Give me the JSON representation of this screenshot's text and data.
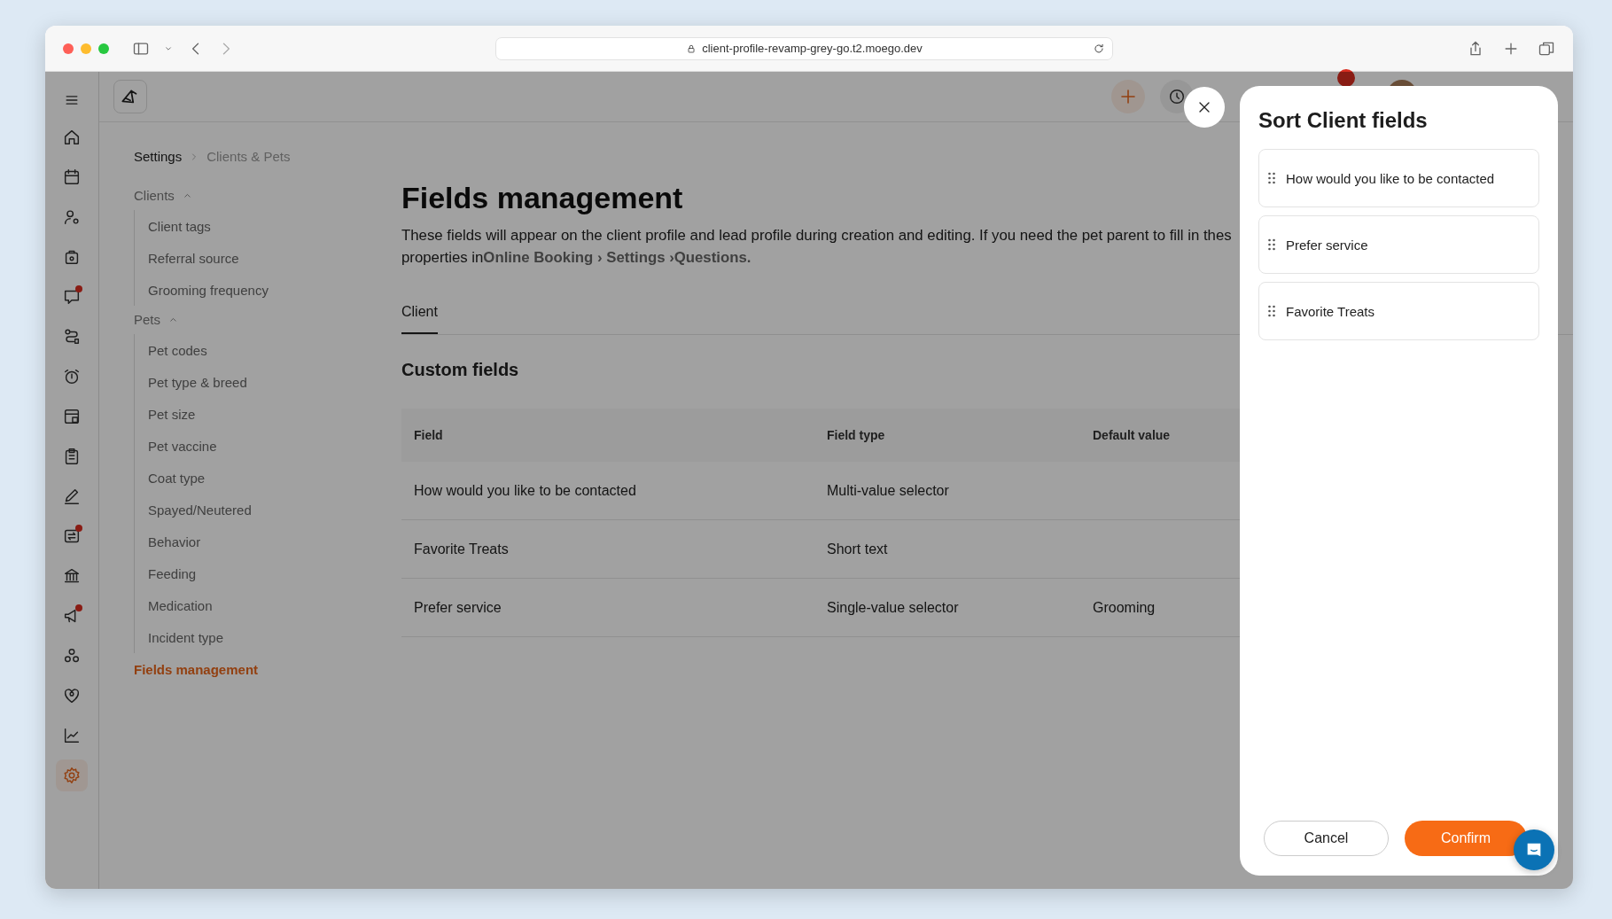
{
  "browser": {
    "url": "client-profile-revamp-grey-go.t2.moego.dev"
  },
  "rail": [
    {
      "kind": "home",
      "dot": false,
      "selected": false
    },
    {
      "kind": "calendar",
      "dot": false,
      "selected": false
    },
    {
      "kind": "client",
      "dot": false,
      "selected": false
    },
    {
      "kind": "bag",
      "dot": false,
      "selected": false
    },
    {
      "kind": "chat",
      "dot": true,
      "selected": false
    },
    {
      "kind": "route",
      "dot": false,
      "selected": false
    },
    {
      "kind": "alarm",
      "dot": false,
      "selected": false
    },
    {
      "kind": "store",
      "dot": false,
      "selected": false
    },
    {
      "kind": "clipboard",
      "dot": false,
      "selected": false
    },
    {
      "kind": "pen",
      "dot": false,
      "selected": false
    },
    {
      "kind": "swap",
      "dot": true,
      "selected": false
    },
    {
      "kind": "bank",
      "dot": false,
      "selected": false
    },
    {
      "kind": "megaphone",
      "dot": true,
      "selected": false
    },
    {
      "kind": "paws",
      "dot": false,
      "selected": false
    },
    {
      "kind": "heart",
      "dot": false,
      "selected": false
    },
    {
      "kind": "chart",
      "dot": false,
      "selected": false
    },
    {
      "kind": "gear",
      "dot": false,
      "selected": true
    }
  ],
  "breadcrumb": [
    "Settings",
    "Clients & Pets"
  ],
  "nav": [
    {
      "label": "Clients",
      "expanded": true,
      "selected": false,
      "children": [
        {
          "label": "Client tags",
          "selected": false
        },
        {
          "label": "Referral source",
          "selected": false
        },
        {
          "label": "Grooming frequency",
          "selected": false
        }
      ]
    },
    {
      "label": "Pets",
      "expanded": true,
      "selected": false,
      "children": [
        {
          "label": "Pet codes",
          "selected": false
        },
        {
          "label": "Pet type & breed",
          "selected": false
        },
        {
          "label": "Pet size",
          "selected": false
        },
        {
          "label": "Pet vaccine",
          "selected": false
        },
        {
          "label": "Coat type",
          "selected": false
        },
        {
          "label": "Spayed/Neutered",
          "selected": false
        },
        {
          "label": "Behavior",
          "selected": false
        },
        {
          "label": "Feeding",
          "selected": false
        },
        {
          "label": "Medication",
          "selected": false
        },
        {
          "label": "Incident type",
          "selected": false
        }
      ]
    },
    {
      "label": "Fields management",
      "selected": true
    }
  ],
  "page": {
    "title": "Fields management",
    "description": "These fields will appear on the client profile and lead profile during creation and editing. If you need the pet parent to fill in thes\nproperties in**Online Booking › Settings ›Questions.**"
  },
  "tabs": [
    {
      "label": "Client",
      "selected": true
    }
  ],
  "section": "Custom fields",
  "table": {
    "columns": [
      "Field",
      "Field type",
      "Default value"
    ],
    "rows": [
      {
        "field": "How would you like to be contacted",
        "field_type": "Multi-value selector"
      },
      {
        "field": "Favorite Treats",
        "field_type": "Short text"
      },
      {
        "field": "Prefer service",
        "field_type": "Single-value selector",
        "default_value": "Grooming"
      }
    ]
  },
  "drawer": {
    "title": "Sort Client fields",
    "items": [
      "How would you like to be contacted",
      "Prefer service",
      "Favorite Treats"
    ],
    "buttons": [
      {
        "label": "Cancel",
        "kind": "secondary"
      },
      {
        "label": "Confirm",
        "kind": "primary"
      }
    ]
  }
}
